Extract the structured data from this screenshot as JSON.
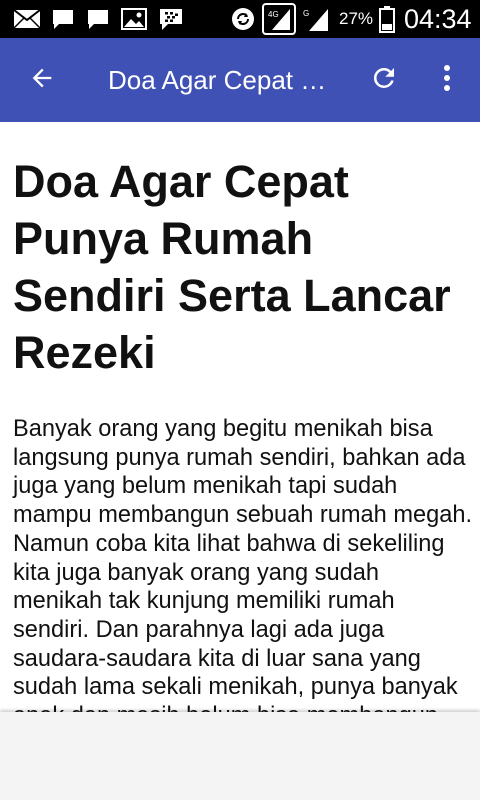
{
  "status_bar": {
    "battery_percent": "27%",
    "time": "04:34",
    "icons": [
      "mail-icon",
      "chat-icon",
      "chat-icon",
      "image-icon",
      "bbm-icon",
      "sync-icon",
      "signal-icon",
      "signal-icon",
      "battery-icon"
    ]
  },
  "app_bar": {
    "title": "Doa Agar Cepat Punya Rumah Sendiri Serta Lancar Rezeki",
    "back_icon": "arrow-back-icon",
    "refresh_icon": "refresh-icon",
    "menu_icon": "more-vert-icon"
  },
  "article": {
    "title": "Doa Agar Cepat Punya Rumah Sendiri Serta Lancar Rezeki",
    "body": "Banyak orang yang begitu menikah bisa langsung punya rumah sendiri, bahkan ada juga yang belum menikah tapi sudah mampu membangun sebuah rumah megah. Namun coba kita lihat bahwa di sekeliling kita juga banyak orang yang sudah menikah tak kunjung memiliki rumah sendiri. Dan parahnya lagi ada juga saudara-saudara kita di luar sana yang sudah lama sekali menikah, punya banyak anak dan masih belum bisa membangun"
  },
  "colors": {
    "app_bar": "#3f51b5",
    "status_bar": "#000000",
    "text": "#111111",
    "bottom_panel": "#f4f4f4"
  }
}
